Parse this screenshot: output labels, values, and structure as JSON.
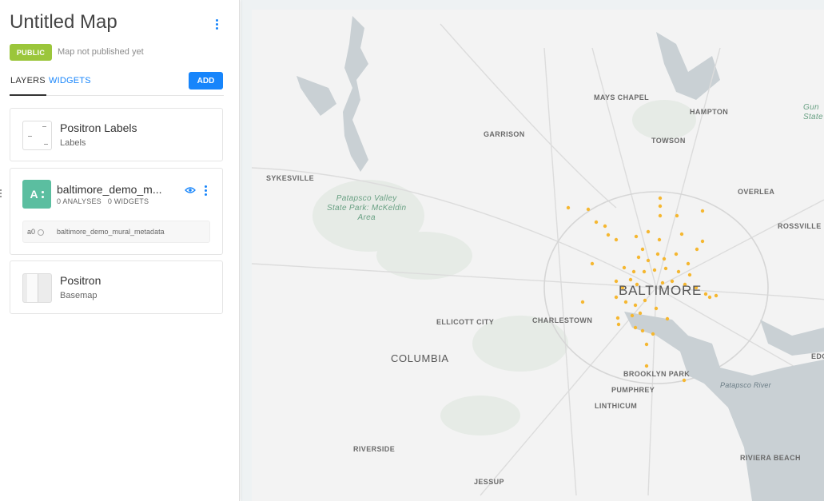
{
  "map_title": "Untitled Map",
  "privacy_badge": "PUBLIC",
  "publish_status": "Map not published yet",
  "tabs": {
    "layers": "LAYERS",
    "widgets": "WIDGETS"
  },
  "add_button": "ADD",
  "layers": [
    {
      "title": "Positron Labels",
      "subtitle": "Labels"
    },
    {
      "letter": "A",
      "title": "baltimore_demo_m...",
      "analyses": "0 ANALYSES",
      "widgets": "0 WIDGETS",
      "analysis_id": "a0",
      "analysis_source": "baltimore_demo_mural_metadata"
    },
    {
      "title": "Positron",
      "subtitle": "Basemap"
    }
  ],
  "map": {
    "labels": {
      "mays_chapel": "MAYS CHAPEL",
      "hampton": "HAMPTON",
      "garrison": "GARRISON",
      "towson": "TOWSON",
      "sykesville": "SYKESVILLE",
      "overlea": "OVERLEA",
      "rossville": "ROSSVILLE",
      "baltimore": "BALTIMORE",
      "ellicott_city": "ELLICOTT CITY",
      "charlestown": "CHARLESTOWN",
      "columbia": "COLUMBIA",
      "brooklyn_park": "BROOKLYN PARK",
      "pumphrey": "PUMPHREY",
      "linthicum": "LINTHICUM",
      "riverside": "RIVERSIDE",
      "jessup": "JESSUP",
      "riviera_beach": "RIVIERA BEACH",
      "edg": "EDG",
      "patapsco_river": "Patapsco River",
      "patapsco_park_line1": "Patapsco Valley",
      "patapsco_park_line2": "State Park: McKeldin",
      "patapsco_park_line3": "Area",
      "gun_line1": "Gun",
      "gun_line2": "State"
    },
    "point_color": "#f5b731",
    "water_color": "#d3d8db",
    "park_color": "#dde7de"
  }
}
